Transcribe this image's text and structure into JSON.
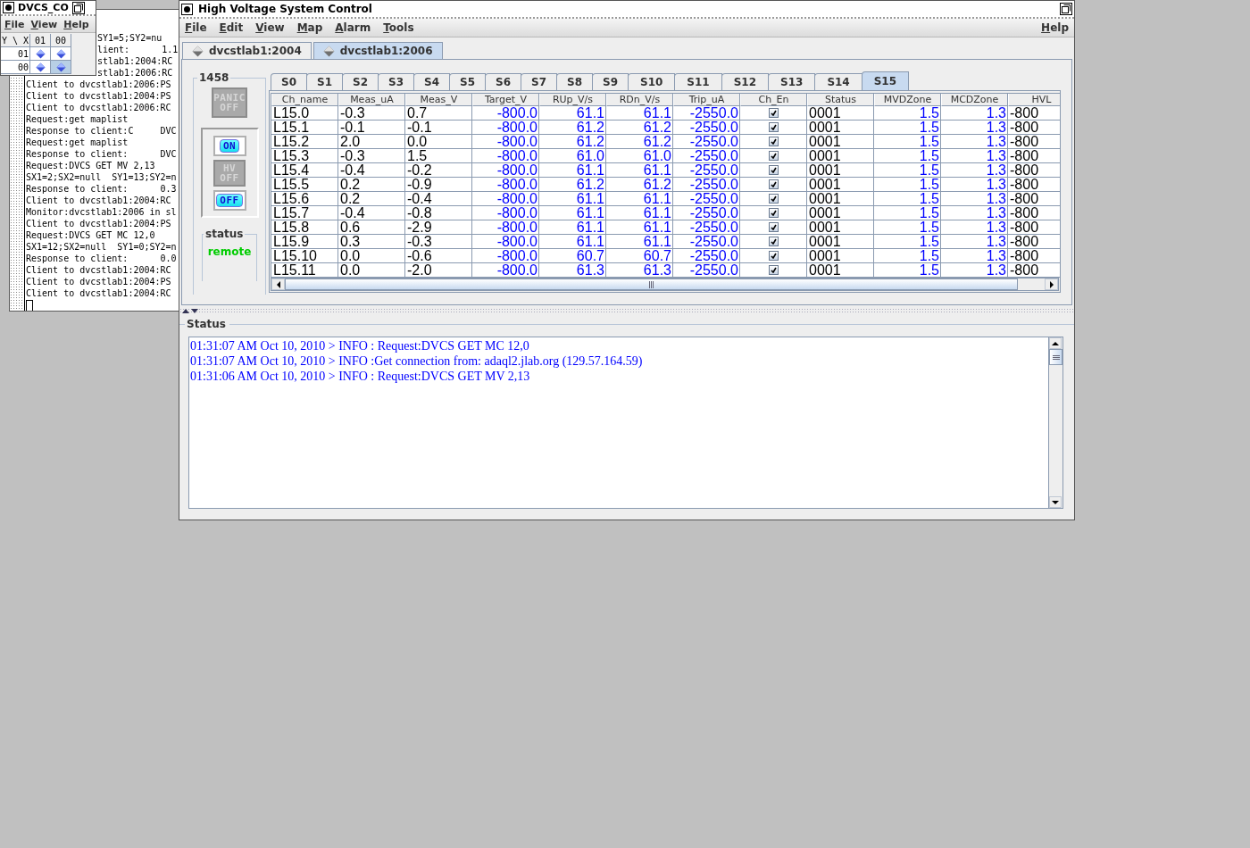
{
  "console_window": {
    "lines": [
      {
        "text": "SY1=5;SY2=nu",
        "kind": "clipped"
      },
      {
        "text": "lient:      1.1",
        "kind": "clipped"
      },
      {
        "text": "stlab1:2004:RC",
        "kind": "clipped"
      },
      {
        "text": "stlab1:2006:RC",
        "kind": "clipped"
      },
      {
        "text": "Client to dvcstlab1:2006:PS",
        "kind": "full"
      },
      {
        "text": "Client to dvcstlab1:2004:PS",
        "kind": "full"
      },
      {
        "text": "Client to dvcstlab1:2006:RC",
        "kind": "full"
      },
      {
        "text": "Request:get maplist",
        "kind": "full"
      },
      {
        "text": "Response to client:C     DVC",
        "kind": "full"
      },
      {
        "text": "Request:get maplist",
        "kind": "full"
      },
      {
        "text": "Response to client:      DVC",
        "kind": "full"
      },
      {
        "text": "Request:DVCS GET MV 2,13",
        "kind": "full"
      },
      {
        "text": "SX1=2;SX2=null  SY1=13;SY2=n",
        "kind": "full"
      },
      {
        "text": "Response to client:      0.3",
        "kind": "full"
      },
      {
        "text": "Client to dvcstlab1:2004:RC",
        "kind": "full"
      },
      {
        "text": "Monitor:dvcstlab1:2006 in sl",
        "kind": "full"
      },
      {
        "text": "Client to dvcstlab1:2004:PS",
        "kind": "full"
      },
      {
        "text": "Request:DVCS GET MC 12,0",
        "kind": "full"
      },
      {
        "text": "SX1=12;SX2=null  SY1=0;SY2=n",
        "kind": "full"
      },
      {
        "text": "Response to client:      0.0",
        "kind": "full"
      },
      {
        "text": "Client to dvcstlab1:2004:RC",
        "kind": "full"
      },
      {
        "text": "Client to dvcstlab1:2004:PS",
        "kind": "full"
      },
      {
        "text": "Client to dvcstlab1:2004:RC",
        "kind": "full"
      }
    ]
  },
  "map_window": {
    "title": "DVCS_CO",
    "menu": [
      "File",
      "View",
      "Help"
    ],
    "corner": "Y \\ X",
    "columns": [
      "01",
      "00"
    ],
    "rows": [
      {
        "label": "01",
        "cells": [
          {
            "selected": false
          },
          {
            "selected": false
          }
        ]
      },
      {
        "label": "00",
        "cells": [
          {
            "selected": false
          },
          {
            "selected": true
          }
        ]
      }
    ]
  },
  "main_window": {
    "title": "High Voltage System Control",
    "menu": [
      "File",
      "Edit",
      "View",
      "Map",
      "Alarm",
      "Tools"
    ],
    "menu_right": [
      "Help"
    ],
    "host_tabs": [
      {
        "label": "dvcstlab1:2004",
        "selected": false
      },
      {
        "label": "dvcstlab1:2006",
        "selected": true
      }
    ],
    "crate": {
      "title": "1458",
      "panic_button": {
        "label": [
          "PANIC",
          "OFF"
        ],
        "disabled": true
      },
      "buttons": [
        {
          "label": [
            "ON"
          ],
          "disabled": false
        },
        {
          "label": [
            "HV",
            "OFF"
          ],
          "disabled": true
        },
        {
          "label": [
            "OFF"
          ],
          "disabled": false
        }
      ],
      "status": {
        "title": "status",
        "value": "remote"
      }
    },
    "slot_tabs": [
      {
        "label": "S0",
        "selected": false
      },
      {
        "label": "S1",
        "selected": false
      },
      {
        "label": "S2",
        "selected": false
      },
      {
        "label": "S3",
        "selected": false
      },
      {
        "label": "S4",
        "selected": false
      },
      {
        "label": "S5",
        "selected": false
      },
      {
        "label": "S6",
        "selected": false
      },
      {
        "label": "S7",
        "selected": false
      },
      {
        "label": "S8",
        "selected": false
      },
      {
        "label": "S9",
        "selected": false
      },
      {
        "label": "S10",
        "selected": false
      },
      {
        "label": "S11",
        "selected": false
      },
      {
        "label": "S12",
        "selected": false
      },
      {
        "label": "S13",
        "selected": false
      },
      {
        "label": "S14",
        "selected": false
      },
      {
        "label": "S15",
        "selected": true
      }
    ],
    "table": {
      "columns": [
        {
          "label": "Ch_name",
          "kind": "text",
          "editable": false
        },
        {
          "label": "Meas_uA",
          "kind": "text",
          "editable": false
        },
        {
          "label": "Meas_V",
          "kind": "text",
          "editable": false
        },
        {
          "label": "Target_V",
          "kind": "text",
          "editable": true
        },
        {
          "label": "RUp_V/s",
          "kind": "text",
          "editable": true
        },
        {
          "label": "RDn_V/s",
          "kind": "text",
          "editable": true
        },
        {
          "label": "Trip_uA",
          "kind": "text",
          "editable": true
        },
        {
          "label": "Ch_En",
          "kind": "check"
        },
        {
          "label": "Status",
          "kind": "text",
          "editable": false
        },
        {
          "label": "MVDZone",
          "kind": "text",
          "editable": true
        },
        {
          "label": "MCDZone",
          "kind": "text",
          "editable": true
        },
        {
          "label": "HVL",
          "kind": "text",
          "editable": false
        }
      ],
      "rows": [
        {
          "cells": [
            "L15.0",
            "-0.3",
            "0.7",
            "-800.0",
            "61.1",
            "61.1",
            "-2550.0",
            true,
            "0001",
            "1.5",
            "1.3",
            "-800"
          ]
        },
        {
          "cells": [
            "L15.1",
            "-0.1",
            "-0.1",
            "-800.0",
            "61.2",
            "61.2",
            "-2550.0",
            true,
            "0001",
            "1.5",
            "1.3",
            "-800"
          ]
        },
        {
          "cells": [
            "L15.2",
            "2.0",
            "0.0",
            "-800.0",
            "61.2",
            "61.2",
            "-2550.0",
            true,
            "0001",
            "1.5",
            "1.3",
            "-800"
          ]
        },
        {
          "cells": [
            "L15.3",
            "-0.3",
            "1.5",
            "-800.0",
            "61.0",
            "61.0",
            "-2550.0",
            true,
            "0001",
            "1.5",
            "1.3",
            "-800"
          ]
        },
        {
          "cells": [
            "L15.4",
            "-0.4",
            "-0.2",
            "-800.0",
            "61.1",
            "61.1",
            "-2550.0",
            true,
            "0001",
            "1.5",
            "1.3",
            "-800"
          ]
        },
        {
          "cells": [
            "L15.5",
            "0.2",
            "-0.9",
            "-800.0",
            "61.2",
            "61.2",
            "-2550.0",
            true,
            "0001",
            "1.5",
            "1.3",
            "-800"
          ]
        },
        {
          "cells": [
            "L15.6",
            "0.2",
            "-0.4",
            "-800.0",
            "61.1",
            "61.1",
            "-2550.0",
            true,
            "0001",
            "1.5",
            "1.3",
            "-800"
          ]
        },
        {
          "cells": [
            "L15.7",
            "-0.4",
            "-0.8",
            "-800.0",
            "61.1",
            "61.1",
            "-2550.0",
            true,
            "0001",
            "1.5",
            "1.3",
            "-800"
          ]
        },
        {
          "cells": [
            "L15.8",
            "0.6",
            "-2.9",
            "-800.0",
            "61.1",
            "61.1",
            "-2550.0",
            true,
            "0001",
            "1.5",
            "1.3",
            "-800"
          ]
        },
        {
          "cells": [
            "L15.9",
            "0.3",
            "-0.3",
            "-800.0",
            "61.1",
            "61.1",
            "-2550.0",
            true,
            "0001",
            "1.5",
            "1.3",
            "-800"
          ]
        },
        {
          "cells": [
            "L15.10",
            "0.0",
            "-0.6",
            "-800.0",
            "60.7",
            "60.7",
            "-2550.0",
            true,
            "0001",
            "1.5",
            "1.3",
            "-800"
          ]
        },
        {
          "cells": [
            "L15.11",
            "0.0",
            "-2.0",
            "-800.0",
            "61.3",
            "61.3",
            "-2550.0",
            true,
            "0001",
            "1.5",
            "1.3",
            "-800"
          ]
        }
      ]
    },
    "status_panel": {
      "title": "Status",
      "lines": [
        "01:31:07 AM Oct 10, 2010 > INFO : Request:DVCS GET MC 12,0",
        "01:31:07 AM Oct 10, 2010 > INFO :Get connection from: adaql2.jlab.org (129.57.164.59)",
        "01:31:06 AM Oct 10, 2010 > INFO : Request:DVCS GET MV 2,13"
      ]
    }
  }
}
